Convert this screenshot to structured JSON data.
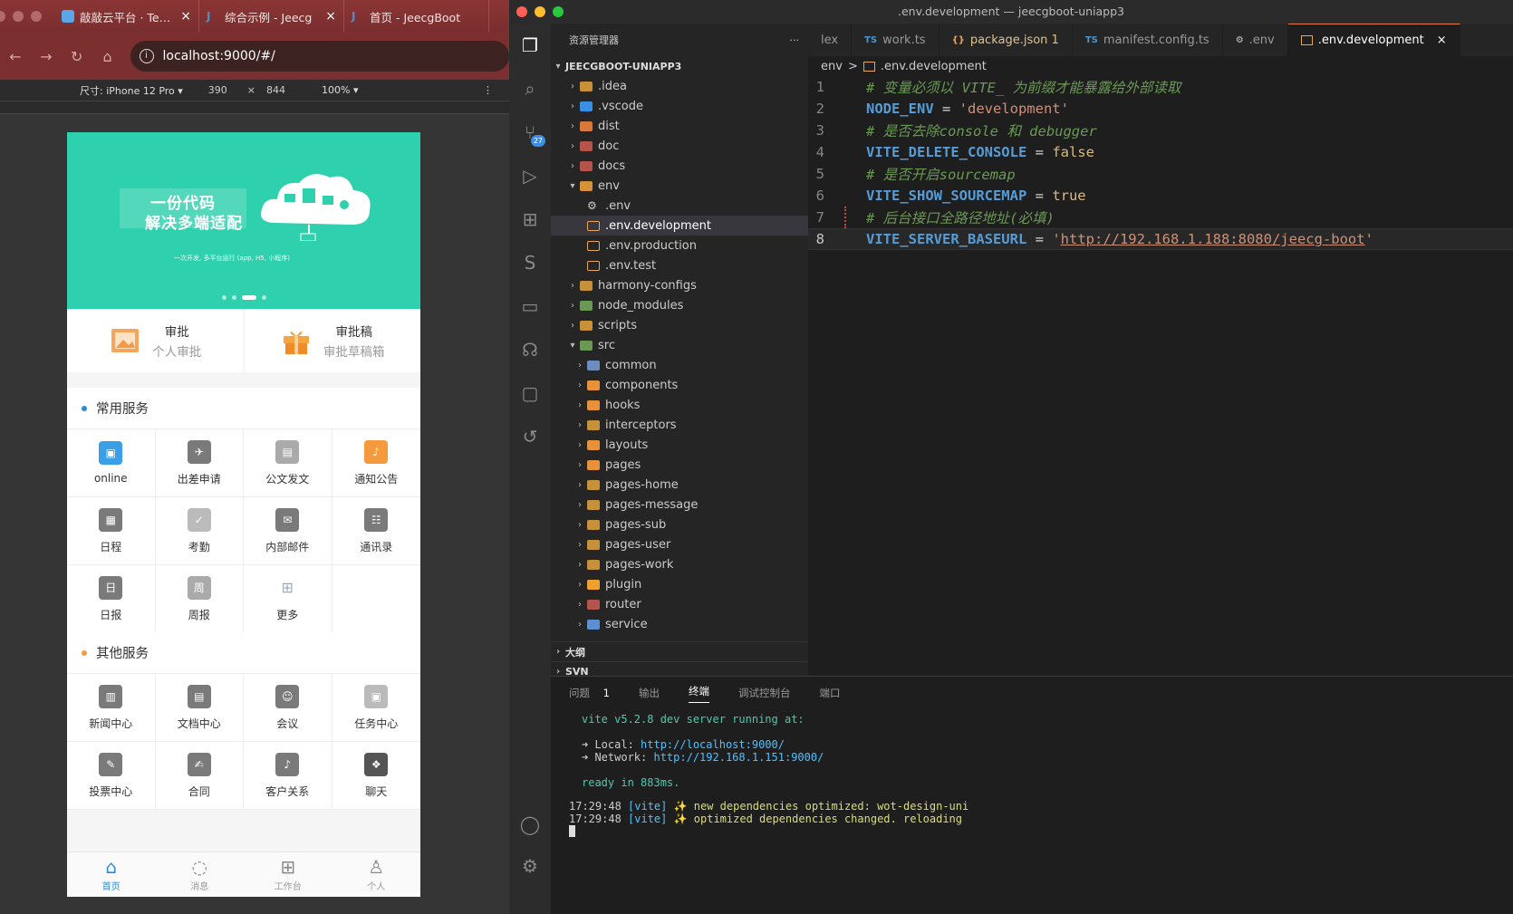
{
  "browser": {
    "tabs": [
      {
        "title": "敲敲云平台 · Team"
      },
      {
        "title": "综合示例 - Jeecg"
      },
      {
        "title": "首页 - JeecgBoot"
      }
    ],
    "url": "localhost:9000/#/",
    "device": {
      "label": "尺寸: iPhone 12 Pro ▾",
      "width": "390",
      "times": "×",
      "height": "844",
      "zoom": "100% ▾",
      "menu": "⋮"
    }
  },
  "phone": {
    "banner": {
      "line1": "一份代码",
      "line2": "解决多端适配",
      "tagline": "一次开发, 多平台运行 (app, H5, 小程序)"
    },
    "quick": [
      {
        "title": "审批",
        "sub": "个人审批"
      },
      {
        "title": "审批稿",
        "sub": "审批草稿箱"
      }
    ],
    "common": {
      "title": "常用服务",
      "items": [
        "online",
        "出差申请",
        "公文发文",
        "通知公告",
        "日程",
        "考勤",
        "内部邮件",
        "通讯录",
        "日报",
        "周报",
        "更多"
      ]
    },
    "other": {
      "title": "其他服务",
      "items": [
        "新闻中心",
        "文档中心",
        "会议",
        "任务中心",
        "投票中心",
        "合同",
        "客户关系",
        "聊天"
      ]
    },
    "tabbar": [
      {
        "label": "首页",
        "icon": "home-icon"
      },
      {
        "label": "消息",
        "icon": "message-icon"
      },
      {
        "label": "工作台",
        "icon": "grid-icon"
      },
      {
        "label": "个人",
        "icon": "user-icon"
      }
    ]
  },
  "vscode": {
    "window_title": ".env.development — jeecgboot-uniapp3",
    "explorer_title": "资源管理器",
    "more": "···",
    "tabs": [
      {
        "label": "lex",
        "lang": ""
      },
      {
        "label": "work.ts",
        "lang": "TS"
      },
      {
        "label": "package.json 1",
        "lang": "{}"
      },
      {
        "label": "manifest.config.ts",
        "lang": "TS"
      },
      {
        "label": ".env",
        "lang": "⚙"
      },
      {
        "label": ".env.development",
        "lang": ""
      }
    ],
    "close": "×",
    "breadcrumb": {
      "folder": "env",
      "sep": ">",
      "file": ".env.development"
    },
    "root": "JEECGBOOT-UNIAPP3",
    "tree": [
      ".idea",
      ".vscode",
      "dist",
      "doc",
      "docs",
      "env",
      ".env",
      ".env.development",
      ".env.production",
      ".env.test",
      "harmony-configs",
      "node_modules",
      "scripts",
      "src",
      "common",
      "components",
      "hooks",
      "interceptors",
      "layouts",
      "pages",
      "pages-home",
      "pages-message",
      "pages-sub",
      "pages-user",
      "pages-work",
      "plugin",
      "router",
      "service"
    ],
    "outline": "大纲",
    "svn": "SVN",
    "scm_badge": "27",
    "code": {
      "line1": "# 变量必须以 VITE_ 为前缀才能暴露给外部读取",
      "line2_key": "NODE_ENV",
      "line2_val": "'development'",
      "line3": "# 是否去除console 和 debugger",
      "line4_key": "VITE_DELETE_CONSOLE",
      "line4_val": "false",
      "line5": "# 是否开启sourcemap",
      "line6_key": "VITE_SHOW_SOURCEMAP",
      "line6_val": "true",
      "line7": "# 后台接口全路径地址(必填)",
      "line8_key": "VITE_SERVER_BASEURL",
      "line8_url": "http://192.168.1.188:8080/jeecg-boot",
      "eq": " = ",
      "q": "'"
    },
    "line_numbers": [
      "1",
      "2",
      "3",
      "4",
      "5",
      "6",
      "7",
      "8"
    ],
    "panel": {
      "tabs": [
        "问题",
        "1",
        "输出",
        "终端",
        "调试控制台",
        "端口"
      ],
      "terminal": {
        "l1": "vite v5.2.8 dev server running at:",
        "l2a": "➜  Local:   ",
        "l2b": "http://localhost:9000/",
        "l3a": "➜  Network: ",
        "l3b": "http://192.168.1.151:9000/",
        "l4": "ready in 883ms.",
        "l5a": "17:29:48 ",
        "l5b": "[vite]",
        "l5c": " ✨ new dependencies optimized: wot-design-uni",
        "l6a": "17:29:48 ",
        "l6b": "[vite]",
        "l6c": " ✨ optimized dependencies changed. reloading"
      }
    }
  }
}
